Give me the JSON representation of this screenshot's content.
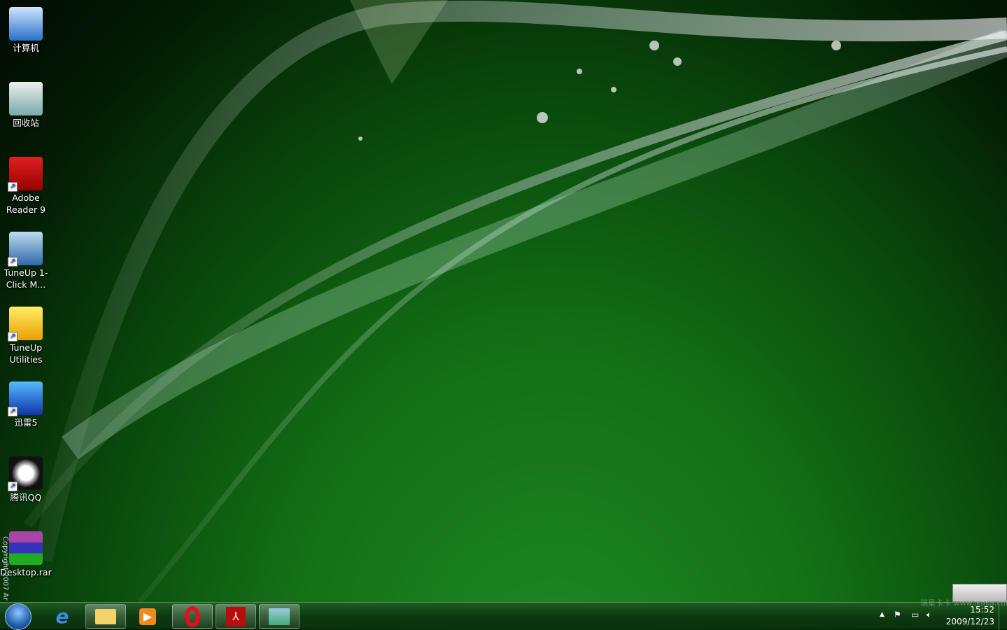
{
  "desktop": {
    "icons": [
      {
        "label": "计算机",
        "icon": "computer-icon",
        "shortcut": false
      },
      {
        "label": "回收站",
        "icon": "recycle-bin-icon",
        "shortcut": false
      },
      {
        "label": "Adobe Reader 9",
        "icon": "adobe-reader-icon",
        "shortcut": true
      },
      {
        "label": "TuneUp 1-Click M...",
        "icon": "tuneup-1click-icon",
        "shortcut": true
      },
      {
        "label": "TuneUp Utilities",
        "icon": "tuneup-utilities-icon",
        "shortcut": true
      },
      {
        "label": "迅雷5",
        "icon": "thunder-icon",
        "shortcut": true
      },
      {
        "label": "腾讯QQ",
        "icon": "qq-icon",
        "shortcut": true
      },
      {
        "label": "Desktop.rar",
        "icon": "winrar-archive-icon",
        "shortcut": false
      }
    ],
    "copyright": "Copyright 2007 Ar"
  },
  "taskbar": {
    "items": [
      "internet-explorer",
      "windows-explorer",
      "media-player",
      "opera",
      "adobe-reader",
      "photo-viewer"
    ],
    "clock": {
      "time": "15:52",
      "date": "2009/12/23"
    },
    "watermark": "瑞星卡卡 www.ikaka.com"
  }
}
